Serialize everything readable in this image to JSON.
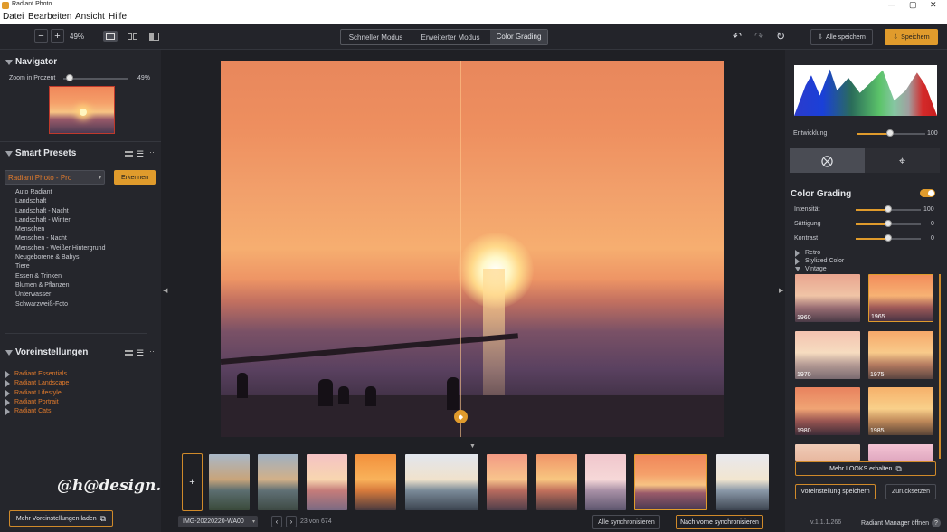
{
  "app": {
    "title": "Radiant Photo",
    "menus": [
      "Datei",
      "Bearbeiten",
      "Ansicht",
      "Hilfe"
    ]
  },
  "toolbar": {
    "zoom": "49%",
    "modes": [
      "Schneller Modus",
      "Erweiterter Modus",
      "Color Grading"
    ],
    "active_mode": "Color Grading",
    "save_all": "Alle speichern",
    "save": "Speichern"
  },
  "navigator": {
    "title": "Navigator",
    "zoom_label": "Zoom in Prozent",
    "zoom_value": "49%",
    "zoom_fraction": 0.49
  },
  "smart_presets": {
    "title": "Smart Presets",
    "selected": "Radiant Photo - Pro",
    "detect_button": "Erkennen",
    "items": [
      "Auto Radiant",
      "Landschaft",
      "Landschaft - Nacht",
      "Landschaft - Winter",
      "Menschen",
      "Menschen - Nacht",
      "Menschen - Weißer Hintergrund",
      "Neugeborene & Babys",
      "Tiere",
      "Essen & Trinken",
      "Blumen & Pflanzen",
      "Unterwasser",
      "Schwarzweiß-Foto"
    ]
  },
  "presets": {
    "title": "Voreinstellungen",
    "items": [
      "Radiant Essentials",
      "Radiant Landscape",
      "Radiant Lifestyle",
      "Radiant Portrait",
      "Radiant Cats"
    ],
    "load_more": "Mehr Voreinstellungen laden"
  },
  "watermark": "@h@design.eu",
  "filmstrip": {
    "filename": "IMG-20220220-WA00",
    "counter": "23 von 674",
    "sync_all": "Alle synchronisieren",
    "sync_front": "Nach vorne synchronisieren",
    "add": "+"
  },
  "right": {
    "development_label": "Entwicklung",
    "development_value": "100",
    "development_fraction": 1.0,
    "color_grading_title": "Color Grading",
    "sliders": [
      {
        "label": "Intensität",
        "value": "100"
      },
      {
        "label": "Sättigung",
        "value": "0"
      },
      {
        "label": "Kontrast",
        "value": "0"
      }
    ],
    "tree": [
      "Retro",
      "Stylized Color",
      "Vintage"
    ],
    "looks": [
      "1960",
      "1965",
      "1970",
      "1975",
      "1980",
      "1985"
    ],
    "more_looks": "Mehr LOOKS erhalten",
    "save_preset": "Voreinstellung speichern",
    "reset": "Zurücksetzen",
    "version": "v.1.1.1.266",
    "manager": "Radiant Manager öffnen"
  },
  "colors": {
    "accent": "#e09b2c",
    "link": "#e07a2c",
    "bg": "#25262c"
  }
}
